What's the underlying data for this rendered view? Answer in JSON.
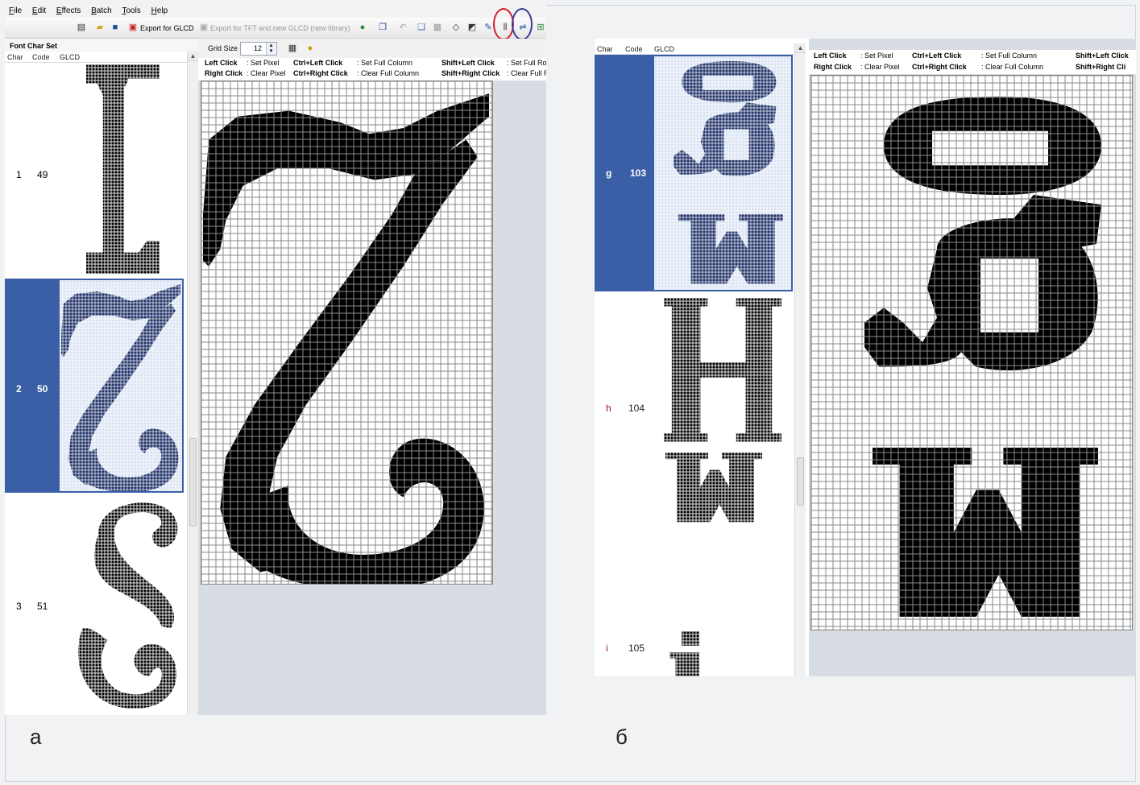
{
  "figure": {
    "caption_a": "а",
    "caption_b": "б"
  },
  "menu": [
    "File",
    "Edit",
    "Effects",
    "Batch",
    "Tools",
    "Help"
  ],
  "toolbar": {
    "export_glcd": "Export for GLCD",
    "export_tft": "Export for TFT and new GLCD (new library)",
    "ring_colors": {
      "mirror": "#d0202a",
      "flip": "#3a3a9a"
    },
    "icons": [
      "new-file-icon",
      "open-icon",
      "save-icon",
      "export-glcd-icon",
      "export-tft-icon",
      "globe-icon",
      "copy-icon",
      "undo-icon",
      "paste-icon",
      "clear-icon",
      "eraser-icon",
      "invert-icon",
      "pen-icon",
      "mirror-icon",
      "flip-icon",
      "add-char-icon"
    ]
  },
  "panel_a": {
    "list_title": "Font Char Set",
    "headers": {
      "char": "Char",
      "code": "Code",
      "glcd": "GLCD"
    },
    "grid_size_label": "Grid Size",
    "grid_size_value": "12",
    "rows": [
      {
        "char": "1",
        "code": "49",
        "selected": false
      },
      {
        "char": "2",
        "code": "50",
        "selected": true
      },
      {
        "char": "3",
        "code": "51",
        "selected": false
      }
    ]
  },
  "help": {
    "left_click": "Left Click",
    "set_pixel": ": Set Pixel",
    "right_click": "Right Click",
    "clear_pixel": ": Clear Pixel",
    "ctrl_left": "Ctrl+Left Click",
    "set_col": ": Set Full Column",
    "ctrl_right": "Ctrl+Right Click",
    "clear_col": ": Clear Full Column",
    "shift_left": "Shift+Left Click",
    "set_row_a": ": Set Full Ro",
    "shift_right": "Shift+Right Click",
    "clear_row_a": ": Clear Full R",
    "shift_left_b": "Shift+Left Click",
    "shift_right_b": "Shift+Right Cli"
  },
  "panel_b": {
    "headers": {
      "char": "Char",
      "code": "Code",
      "glcd": "GLCD"
    },
    "rows": [
      {
        "char": "g",
        "code": "103",
        "selected": true
      },
      {
        "char": "h",
        "code": "104",
        "selected": false
      },
      {
        "char": "i",
        "code": "105",
        "selected": false
      }
    ]
  },
  "colors": {
    "selection": "#3a5fa7",
    "pixel_on": "#000000",
    "pixel_on_selected": "#1d2f66",
    "editor_bg": "#d8dde3"
  }
}
